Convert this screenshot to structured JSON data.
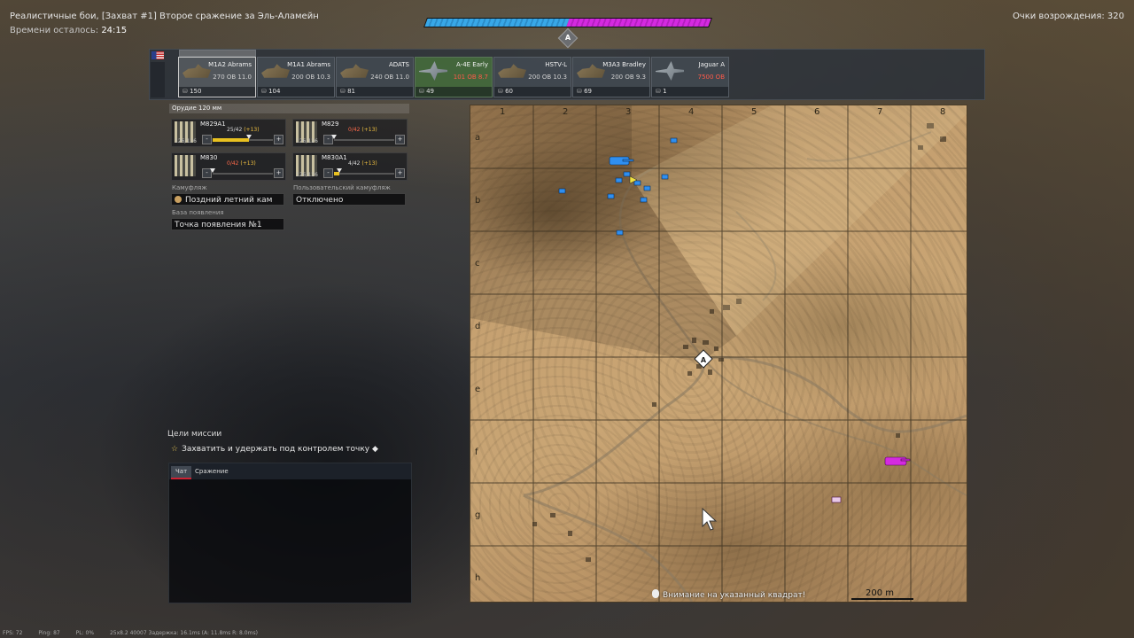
{
  "header": {
    "title": "Реалистичные бои, [Захват #1] Второе сражение за Эль-Аламейн",
    "time_label": "Времени осталось:",
    "time_value": "24:15",
    "respawn_points": "Очки возрождения: 320",
    "zone_letter": "A"
  },
  "score": {
    "blue_fraction": 0.5,
    "pink_fraction": 0.5,
    "blue_color": "#38a8e8",
    "pink_color": "#d42ae0"
  },
  "nation_flag": "usa-flag-icon",
  "vehicles": [
    {
      "name": "M1A2 Abrams",
      "br": "270 ОВ 11.0",
      "br_red": false,
      "count": "150",
      "selected": true,
      "type": "tank"
    },
    {
      "name": "M1A1 Abrams",
      "br": "200 ОВ 10.3",
      "br_red": false,
      "count": "104",
      "selected": false,
      "type": "tank"
    },
    {
      "name": "ADATS",
      "br": "240 ОВ 11.0",
      "br_red": false,
      "count": "81",
      "selected": false,
      "type": "tank"
    },
    {
      "name": "A-4E Early",
      "br": "101 ОВ 8.7",
      "br_red": true,
      "count": "49",
      "selected": false,
      "type": "plane"
    },
    {
      "name": "HSTV-L",
      "br": "200 ОВ 10.3",
      "br_red": false,
      "count": "60",
      "selected": false,
      "type": "tank"
    },
    {
      "name": "M3A3 Bradley",
      "br": "200 ОВ 9.3",
      "br_red": false,
      "count": "69",
      "selected": false,
      "type": "tank"
    },
    {
      "name": "Jaguar A",
      "br": "7500 ОВ",
      "br_red": true,
      "count": "1",
      "selected": false,
      "type": "plane"
    }
  ],
  "weapon": {
    "header": "Орудие 120 мм",
    "ammo": [
      {
        "name": "M829A1",
        "count": "25/42",
        "bonus": "(+13)",
        "hint": "126/126",
        "fill": 0.6,
        "red": false
      },
      {
        "name": "M829",
        "count": "0/42",
        "bonus": "(+13)",
        "hint": "126/126",
        "fill": 0.0,
        "red": true
      },
      {
        "name": "M830",
        "count": "0/42",
        "bonus": "(+13)",
        "hint": "",
        "fill": 0.0,
        "red": true
      },
      {
        "name": "M830A1",
        "count": "4/42",
        "bonus": "(+13)",
        "hint": "126/126",
        "fill": 0.09,
        "red": false
      }
    ]
  },
  "camo": {
    "label": "Камуфляж",
    "value": "Поздний летний кам"
  },
  "custom_camo": {
    "label": "Пользовательский камуфляж",
    "value": "Отключено"
  },
  "spawn": {
    "label": "База появления",
    "value": "Точка появления №1"
  },
  "mission": {
    "title": "Цели миссии",
    "objective": "Захватить и удержать под контролем точку"
  },
  "chat": {
    "tabs": [
      "Чат",
      "Сражение"
    ]
  },
  "map": {
    "columns": [
      "1",
      "2",
      "3",
      "4",
      "5",
      "6",
      "7",
      "8"
    ],
    "rows": [
      "a",
      "b",
      "c",
      "d",
      "e",
      "f",
      "g",
      "h"
    ],
    "scale": "200 m",
    "hint": "Внимание на указанный квадрат!"
  },
  "status_bar": {
    "fps": "FPS: 72",
    "ping": "Ping: 87",
    "pl": "PL: 0%",
    "extra": "25x8.2 40007 Задержка: 16.1ms (A: 11.8ms R: 8.0ms)"
  }
}
